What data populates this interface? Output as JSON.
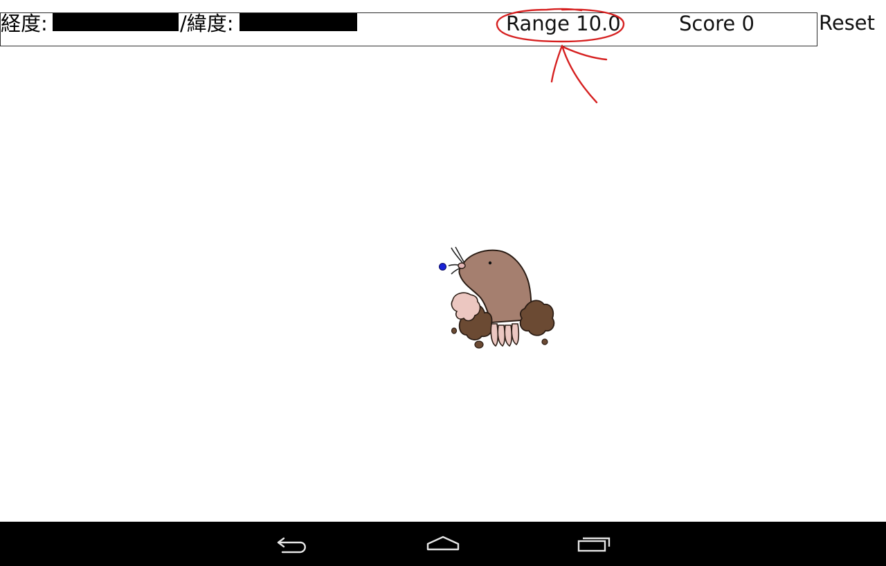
{
  "status_bar": {
    "longitude_label": "経度:",
    "latitude_label": "/緯度:",
    "longitude_value": "",
    "latitude_value": "",
    "range_text": "Range 10.0",
    "score_text": "Score 0",
    "reset_label": "Reset"
  },
  "game": {
    "target_dot_color": "#1a23d6",
    "character": "mole-icon"
  },
  "annotation": {
    "color": "#d62020",
    "shape": "circle-and-arrow"
  },
  "navbar": {
    "back_icon": "back-icon",
    "home_icon": "home-icon",
    "recent_icon": "recent-apps-icon"
  }
}
